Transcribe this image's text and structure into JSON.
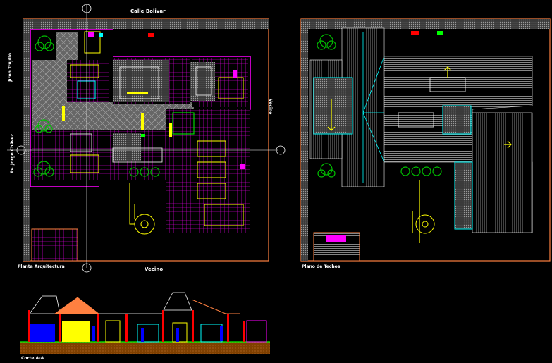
{
  "labels": {
    "street_top": "Calle Bolivar",
    "neighbor_right": "Vecino",
    "neighbor_bottom": "Vecino",
    "street_left": "Jirón Trujillo",
    "street_left_2": "Av. Jorge Chávez",
    "plan_title": "Planta Arquitectura",
    "roof_title": "Plano de Techos",
    "section_title": "Corte A-A"
  },
  "colors": {
    "background": "#000000",
    "wall": "#ff8040",
    "hatch": "#ff00ff",
    "room_gray": "#808080",
    "tree": "#00c000",
    "furniture_yellow": "#ffff00",
    "axis_white": "#ffffff",
    "roof_cyan": "#00ffff",
    "section_ground": "#804000",
    "section_red": "#ff0000",
    "section_blue": "#0000ff",
    "label_white": "#ffffff"
  },
  "icons": [
    "north-arrow-icon",
    "axis-marker-icon",
    "tree-icon",
    "spiral-stair-icon"
  ]
}
